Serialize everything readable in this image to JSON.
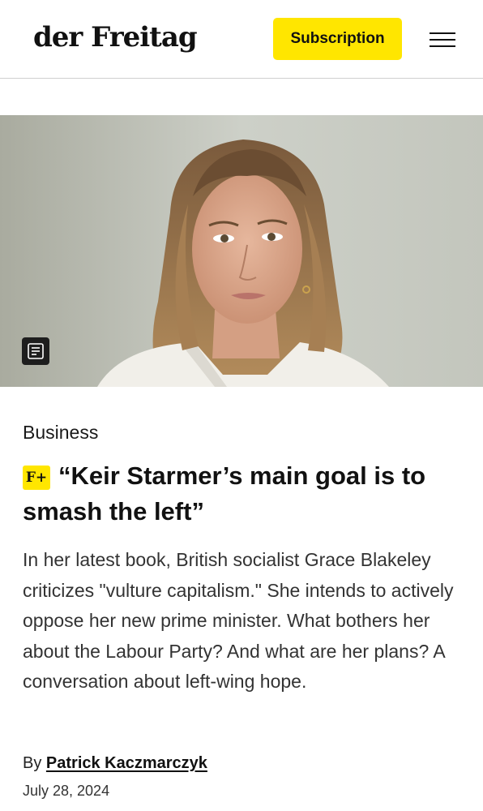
{
  "header": {
    "logo": "der Freitag",
    "subscription_label": "Subscription",
    "menu_icon": "hamburger-menu-icon"
  },
  "hero": {
    "description_icon": "article-icon"
  },
  "article": {
    "section": "Business",
    "premium_badge": "F+",
    "headline": "“Keir Starmer’s main goal is to smash the left”",
    "lead": "In her latest book, British socialist Grace Blakeley criticizes \"vulture capitalism.\" She intends to actively oppose her new prime minister. What bothers her about the Labour Party? And what are her plans? A conversation about left-wing hope.",
    "byline_prefix": "By",
    "author": "Patrick Kaczmarczyk",
    "date": "July 28, 2024"
  },
  "colors": {
    "accent": "#ffe600",
    "text": "#111111",
    "divider": "#cfcfcf"
  }
}
